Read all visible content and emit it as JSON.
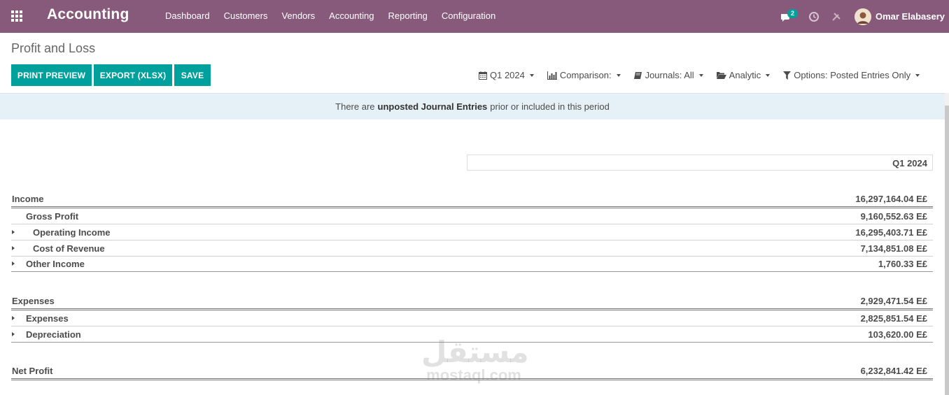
{
  "navbar": {
    "app_name": "Accounting",
    "menu": [
      "Dashboard",
      "Customers",
      "Vendors",
      "Accounting",
      "Reporting",
      "Configuration"
    ],
    "messages_count": "2",
    "user_name": "Omar Elabasery",
    "background_color": "#875a7b"
  },
  "page": {
    "title": "Profit and Loss",
    "buttons": {
      "print": "PRINT PREVIEW",
      "export": "EXPORT (XLSX)",
      "save": "SAVE"
    },
    "accent_color": "#00a09d",
    "filters": {
      "date": "Q1 2024",
      "comparison": "Comparison:",
      "journals": "Journals: All",
      "analytic": "Analytic",
      "options": "Options: Posted Entries Only"
    }
  },
  "alert": {
    "prefix": "There are",
    "emphasis": "unposted Journal Entries",
    "suffix": "prior or included in this period"
  },
  "report": {
    "column_header": "Q1 2024",
    "income": {
      "label": "Income",
      "amount": "16,297,164.04 E£",
      "lines": [
        {
          "label": "Gross Profit",
          "amount": "9,160,552.63 E£"
        },
        {
          "label": "Operating Income",
          "amount": "16,295,403.71 E£"
        },
        {
          "label": "Cost of Revenue",
          "amount": "7,134,851.08 E£"
        },
        {
          "label": "Other Income",
          "amount": "1,760.33 E£"
        }
      ]
    },
    "expenses": {
      "label": "Expenses",
      "amount": "2,929,471.54 E£",
      "lines": [
        {
          "label": "Expenses",
          "amount": "2,825,851.54 E£"
        },
        {
          "label": "Depreciation",
          "amount": "103,620.00 E£"
        }
      ]
    },
    "net_profit": {
      "label": "Net Profit",
      "amount": "6,232,841.42 E£"
    }
  },
  "watermark": {
    "arabic": "مستقل",
    "latin": "mostaql.com"
  }
}
